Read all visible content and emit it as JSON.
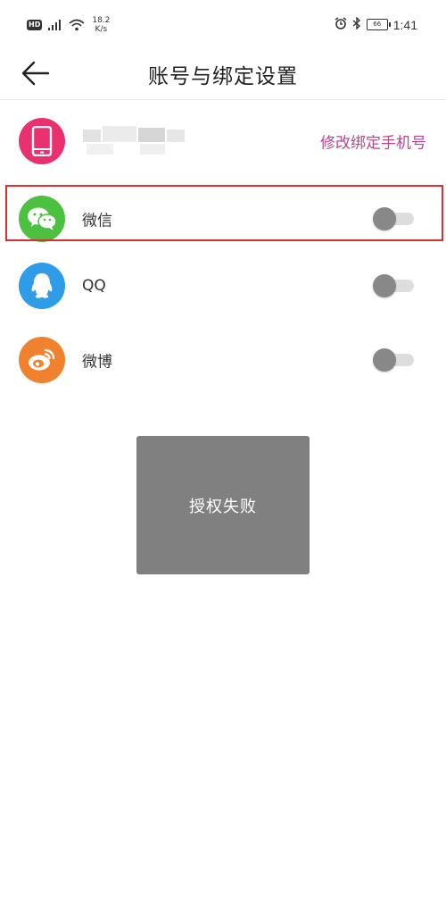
{
  "status_bar": {
    "hd": "HD",
    "network_speed_value": "18.2",
    "network_speed_unit": "K/s",
    "battery_level": "66",
    "time": "1:41"
  },
  "header": {
    "title": "账号与绑定设置"
  },
  "phone_row": {
    "link": "修改绑定手机号"
  },
  "accounts": [
    {
      "label": "微信",
      "enabled": false,
      "icon": "wechat-icon",
      "color": "#4bc13f"
    },
    {
      "label": "QQ",
      "enabled": false,
      "icon": "qq-icon",
      "color": "#2e9ce6"
    },
    {
      "label": "微博",
      "enabled": false,
      "icon": "weibo-icon",
      "color": "#f0822d"
    }
  ],
  "toast": {
    "message": "授权失败"
  },
  "colors": {
    "accent": "#b5488e",
    "phone_icon_bg": "#e8316e",
    "highlight": "#d83030"
  }
}
